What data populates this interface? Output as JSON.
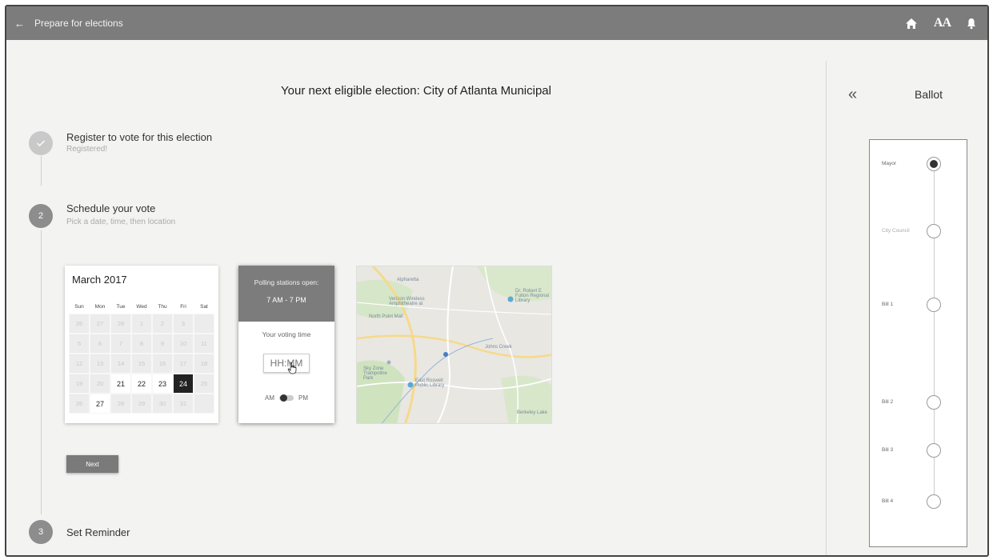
{
  "header": {
    "back_icon": "left-arrow-icon",
    "title": "Prepare for elections",
    "icons": [
      "home-icon",
      "text-size-icon",
      "bell-icon"
    ],
    "text_size_label": "AA"
  },
  "main": {
    "title": "Your next eligible election: City of Atlanta Municipal",
    "steps": [
      {
        "number": "✓",
        "title": "Register to vote for this election",
        "subtitle": "Registered!"
      },
      {
        "number": "2",
        "title": "Schedule your vote",
        "subtitle": "Pick a date, time, then location"
      },
      {
        "number": "3",
        "title": "Set Reminder",
        "subtitle": ""
      }
    ],
    "next_label": "Next"
  },
  "calendar": {
    "month": "March 2017",
    "days_of_week": [
      "Sun",
      "Mon",
      "Tue",
      "Wed",
      "Thu",
      "Fri",
      "Sat"
    ],
    "weeks": [
      [
        "26",
        "27",
        "28",
        "1",
        "2",
        "3",
        ""
      ],
      [
        "5",
        "6",
        "7",
        "8",
        "9",
        "10",
        "11"
      ],
      [
        "12",
        "13",
        "14",
        "15",
        "16",
        "17",
        "18"
      ],
      [
        "19",
        "20",
        "21",
        "22",
        "23",
        "24",
        "25"
      ],
      [
        "26",
        "27",
        "28",
        "29",
        "30",
        "31",
        ""
      ]
    ],
    "available": [
      "21",
      "22",
      "23",
      "27"
    ],
    "selected": "24"
  },
  "polling": {
    "header_label": "Polling stations open:",
    "hours": "7 AM - 7 PM",
    "voting_time_label": "Your voting time",
    "time_placeholder": "HH:MM",
    "am_label": "AM",
    "pm_label": "PM"
  },
  "map": {
    "labels": [
      "Alpharetta",
      "Verizon Wireless Amphitheatre at",
      "North Point Mall",
      "Dr. Robert E Fulton Regional Library",
      "Johns Creek",
      "Sky Zone Trampoline Park",
      "East Roswell Public Library",
      "Berkeley Lake"
    ]
  },
  "ballot": {
    "collapse_icon": "double-chevron-left-icon",
    "title": "Ballot",
    "items": [
      {
        "label": "Mayor",
        "selected": true
      },
      {
        "label": "City Council",
        "selected": false
      },
      {
        "label": "Bill 1",
        "selected": false
      },
      {
        "label": "Bill 2",
        "selected": false
      },
      {
        "label": "Bill 3",
        "selected": false
      },
      {
        "label": "Bill 4",
        "selected": false
      }
    ]
  },
  "colors": {
    "topbar": "#7c7c7c",
    "background": "#f3f3f2",
    "selected_day": "#222222",
    "map_park": "#c9dfb9",
    "map_road": "#f6d98a"
  }
}
